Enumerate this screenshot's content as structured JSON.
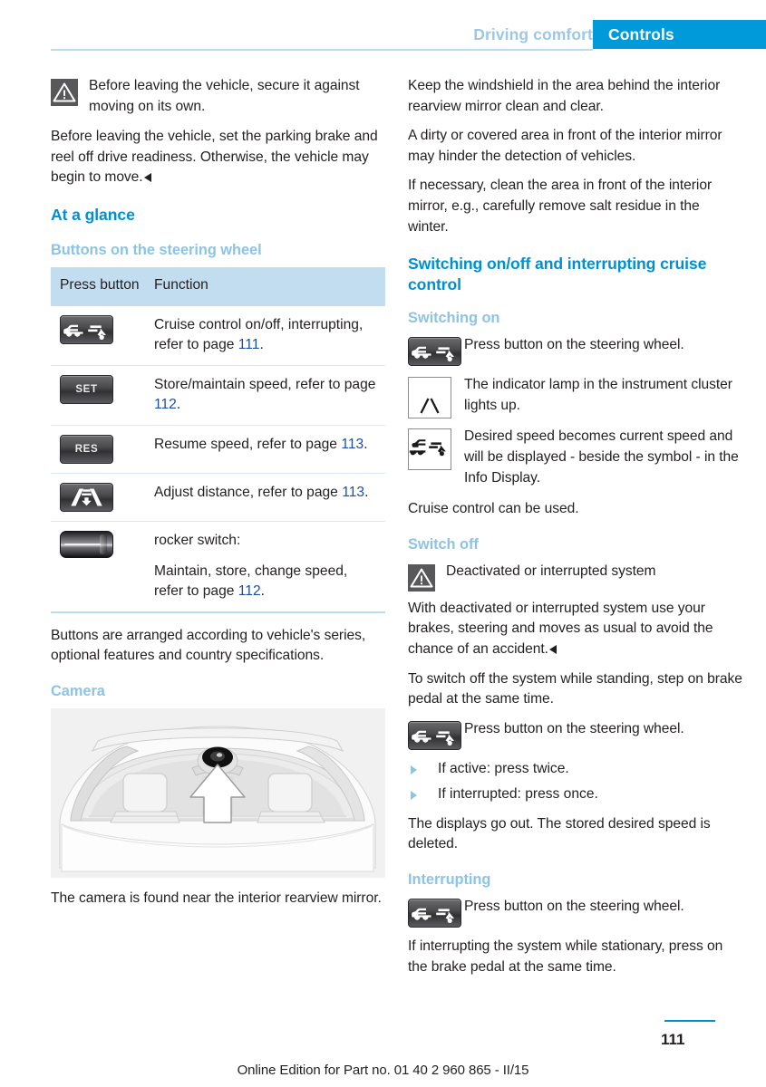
{
  "header": {
    "chapter": "Driving comfort",
    "section_tab": "Controls"
  },
  "left_column": {
    "warning_1": {
      "icon": "warning-triangle-icon",
      "line1": "Before leaving the vehicle, secure it against moving on its own.",
      "line2": "Before leaving the vehicle, set the parking brake and reel off drive readiness. Otherwise, the vehicle may begin to move."
    },
    "heading_at_a_glance": "At a glance",
    "heading_buttons": "Buttons on the steering wheel",
    "table": {
      "headers": [
        "Press button",
        "Function"
      ],
      "rows": [
        {
          "icon": "cruise-control-button-icon",
          "icon_label": "",
          "text_pre": "Cruise control on/off, interrupting, refer to page ",
          "page": "111",
          "text_post": "."
        },
        {
          "icon": "set-button-icon",
          "icon_label": "SET",
          "text_pre": "Store/maintain speed, refer to page ",
          "page": "112",
          "text_post": "."
        },
        {
          "icon": "res-button-icon",
          "icon_label": "RES",
          "text_pre": "Resume speed, refer to page ",
          "page": "113",
          "text_post": "."
        },
        {
          "icon": "adjust-distance-button-icon",
          "icon_label": "",
          "text_pre": "Adjust distance, refer to page ",
          "page": "113",
          "text_post": "."
        }
      ],
      "rocker_row": {
        "icon": "rocker-switch-icon",
        "line1": "rocker switch:",
        "text_pre": "Maintain, store, change speed, refer to page ",
        "page": "112",
        "text_post": "."
      }
    },
    "note_buttons_arranged": "Buttons are arranged according to vehicle's series, optional features and country specifications.",
    "heading_camera": "Camera",
    "figure_caption": "The camera is found near the interior rearview mirror."
  },
  "right_column": {
    "para_1": "Keep the windshield in the area behind the interior rearview mirror clean and clear.",
    "para_2": "A dirty or covered area in front of the interior mirror may hinder the detection of vehicles.",
    "para_3": "If necessary, clean the area in front of the interior mirror, e.g., carefully remove salt residue in the winter.",
    "heading_switching": "Switching on/off and interrupting cruise control",
    "heading_switching_on": "Switching on",
    "step_1": {
      "icon": "cruise-control-button-icon",
      "text": "Press button on the steering wheel."
    },
    "step_2": {
      "icon": "indicator-lamp-icon",
      "text": "The indicator lamp in the instrument cluster lights up."
    },
    "step_3": {
      "icon": "cruise-control-symbol-icon",
      "text": "Desired speed becomes current speed and will be displayed - beside the symbol - in the Info Display."
    },
    "para_cruise_usable": "Cruise control can be used.",
    "heading_switch_off": "Switch off",
    "warning_2": {
      "icon": "warning-triangle-icon",
      "line1": "Deactivated or interrupted system",
      "line2": "With deactivated or interrupted system use your brakes, steering and moves as usual to avoid the chance of an accident."
    },
    "para_switch_off": "To switch off the system while standing, step on brake pedal at the same time.",
    "step_4": {
      "icon": "cruise-control-button-icon",
      "text": "Press button on the steering wheel."
    },
    "bullets": [
      "If active: press twice.",
      "If interrupted: press once."
    ],
    "para_displays_out": "The displays go out. The stored desired speed is deleted.",
    "heading_interrupting": "Interrupting",
    "step_5": {
      "icon": "cruise-control-button-icon",
      "text": "Press button on the steering wheel."
    },
    "para_interrupting": "If interrupting the system while stationary, press on the brake pedal at the same time."
  },
  "footer": {
    "note": "Online Edition for Part no. 01 40 2 960 865 - II/15",
    "page_number": "111"
  },
  "colors": {
    "accent_blue": "#009ada",
    "heading_blue": "#0090d2",
    "light_blue": "#8cc4e6",
    "table_header_bg": "#c3ddf0",
    "page_ref_blue": "#1f4ea8"
  }
}
